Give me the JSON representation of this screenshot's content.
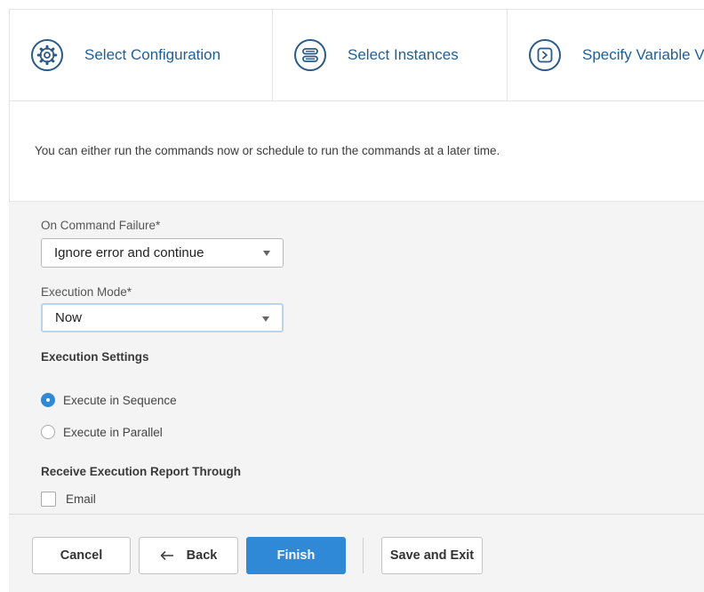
{
  "steps": [
    {
      "label": "Select Configuration",
      "icon": "gear-icon"
    },
    {
      "label": "Select Instances",
      "icon": "server-icon"
    },
    {
      "label": "Specify Variable V",
      "icon": "chevron-right-icon"
    }
  ],
  "intro": {
    "text": "You can either run the commands now or schedule to run the commands at a later time."
  },
  "form": {
    "on_failure": {
      "label": "On Command Failure*",
      "value": "Ignore error and continue"
    },
    "execution_mode": {
      "label": "Execution Mode*",
      "value": "Now"
    },
    "execution_settings": {
      "title": "Execution Settings",
      "options": [
        {
          "label": "Execute in Sequence",
          "selected": true
        },
        {
          "label": "Execute in Parallel",
          "selected": false
        }
      ]
    },
    "report": {
      "title": "Receive Execution Report Through",
      "email_label": "Email",
      "email_checked": false
    }
  },
  "footer": {
    "cancel": "Cancel",
    "back": "Back",
    "finish": "Finish",
    "save_exit": "Save and Exit"
  },
  "colors": {
    "accent": "#2f89d6",
    "step_text": "#1f5f96",
    "step_icon": "#2a5a8c",
    "panel_bg": "#f4f4f4"
  }
}
